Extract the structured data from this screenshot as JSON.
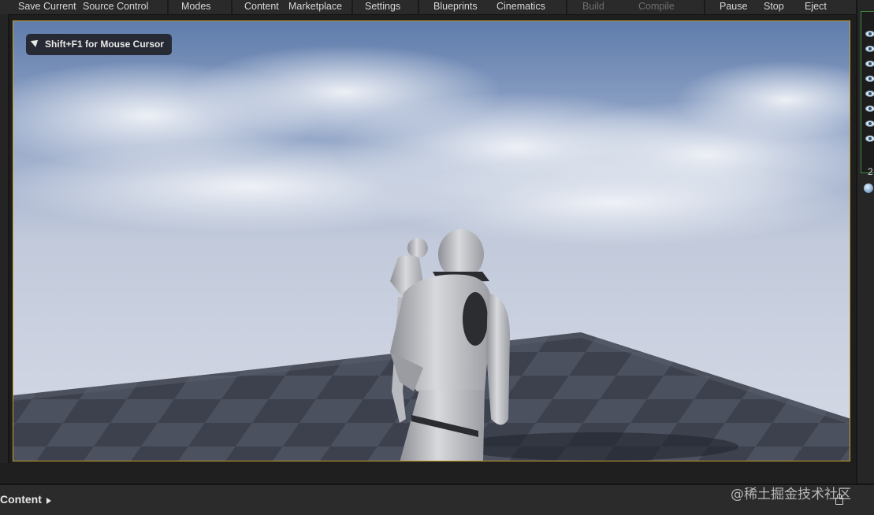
{
  "toolbar": {
    "items": [
      {
        "label": "Save Current",
        "enabled": true
      },
      {
        "label": "Source Control",
        "enabled": true
      },
      {
        "label": "Modes",
        "enabled": true
      },
      {
        "label": "Content",
        "enabled": true
      },
      {
        "label": "Marketplace",
        "enabled": true
      },
      {
        "label": "Settings",
        "enabled": true
      },
      {
        "label": "Blueprints",
        "enabled": true
      },
      {
        "label": "Cinematics",
        "enabled": true
      },
      {
        "label": "Build",
        "enabled": false
      },
      {
        "label": "Compile",
        "enabled": false
      },
      {
        "label": "Pause",
        "enabled": true
      },
      {
        "label": "Stop",
        "enabled": true
      },
      {
        "label": "Eject",
        "enabled": true
      }
    ]
  },
  "viewport": {
    "hint_text": "Shift+F1 for Mouse Cursor",
    "border_color": "#c9a02a",
    "sky_colors": [
      "#5f7cab",
      "#c8cedd"
    ],
    "floor_colors": [
      "#3a3f4b",
      "#4a505e"
    ]
  },
  "outliner": {
    "visible_rows": 8,
    "count_text": "2",
    "border_color": "#3f8a3f"
  },
  "content_browser": {
    "tab_label": "Content",
    "icons": [
      "chevron-right-icon",
      "lock-icon"
    ]
  },
  "watermark": "@稀土掘金技术社区"
}
